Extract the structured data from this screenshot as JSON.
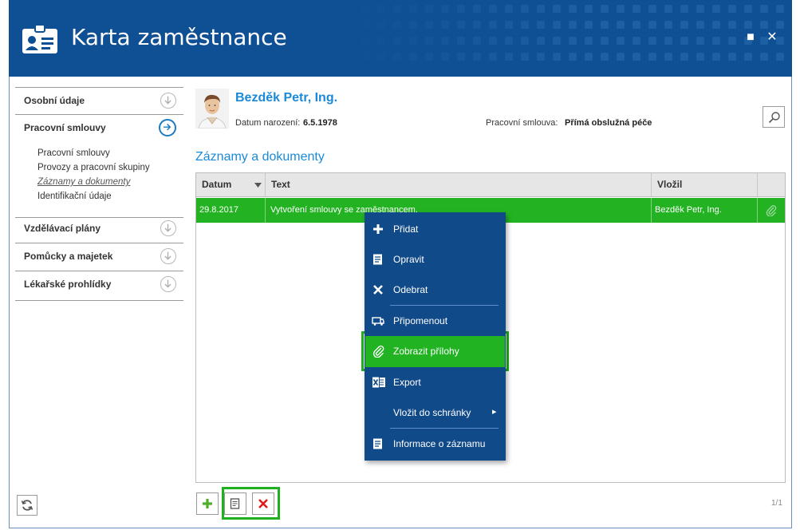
{
  "window": {
    "title": "Karta zaměstnance",
    "maximize_glyph": "■",
    "close_glyph": "✕"
  },
  "sidebar": {
    "sections": [
      {
        "label": "Osobní údaje",
        "icon": "arrow-down-circle-icon"
      },
      {
        "label": "Pracovní smlouvy",
        "icon": "arrow-right-circle-icon",
        "active": true,
        "items": [
          {
            "label": "Pracovní smlouvy"
          },
          {
            "label": "Provozy a pracovní skupiny"
          },
          {
            "label": "Záznamy a dokumenty",
            "current": true
          },
          {
            "label": "Identifikační údaje"
          }
        ]
      },
      {
        "label": "Vzdělávací plány",
        "icon": "arrow-down-circle-icon"
      },
      {
        "label": "Pomůcky a majetek",
        "icon": "arrow-down-circle-icon"
      },
      {
        "label": "Lékařské prohlídky",
        "icon": "arrow-down-circle-icon"
      }
    ]
  },
  "employee": {
    "name": "Bezděk Petr, Ing.",
    "birth_label": "Datum narození:",
    "birth_value": "6.5.1978",
    "contract_label": "Pracovní smlouva:",
    "contract_value": "Přímá obslužná péče"
  },
  "section_title": "Záznamy a dokumenty",
  "grid": {
    "columns": [
      "Datum",
      "Text",
      "Vložil"
    ],
    "rows": [
      {
        "datum": "29.8.2017",
        "text": "Vytvoření smlouvy se zaměstnancem.",
        "vlozil": "Bezděk Petr, Ing.",
        "selected": true
      }
    ]
  },
  "context_menu": {
    "items": [
      {
        "label": "Přidat",
        "icon": "plus-icon"
      },
      {
        "label": "Opravit",
        "icon": "edit-document-icon"
      },
      {
        "label": "Odebrat",
        "icon": "close-icon"
      },
      {
        "label": "Připomenout",
        "icon": "reminder-icon"
      },
      {
        "label": "Zobrazit přílohy",
        "icon": "paperclip-icon",
        "highlighted": true
      },
      {
        "label": "Export",
        "icon": "excel-icon"
      },
      {
        "label": "Vložit do schránky",
        "icon": "",
        "submenu": "▸"
      },
      {
        "label": "Informace o záznamu",
        "icon": "info-document-icon"
      }
    ]
  },
  "pager": "1/1",
  "colors": {
    "header": "#0f4f94",
    "accent": "#1a8ad8",
    "selected_row": "#23b322",
    "menu": "#114a88",
    "highlight": "#1fb01f"
  }
}
